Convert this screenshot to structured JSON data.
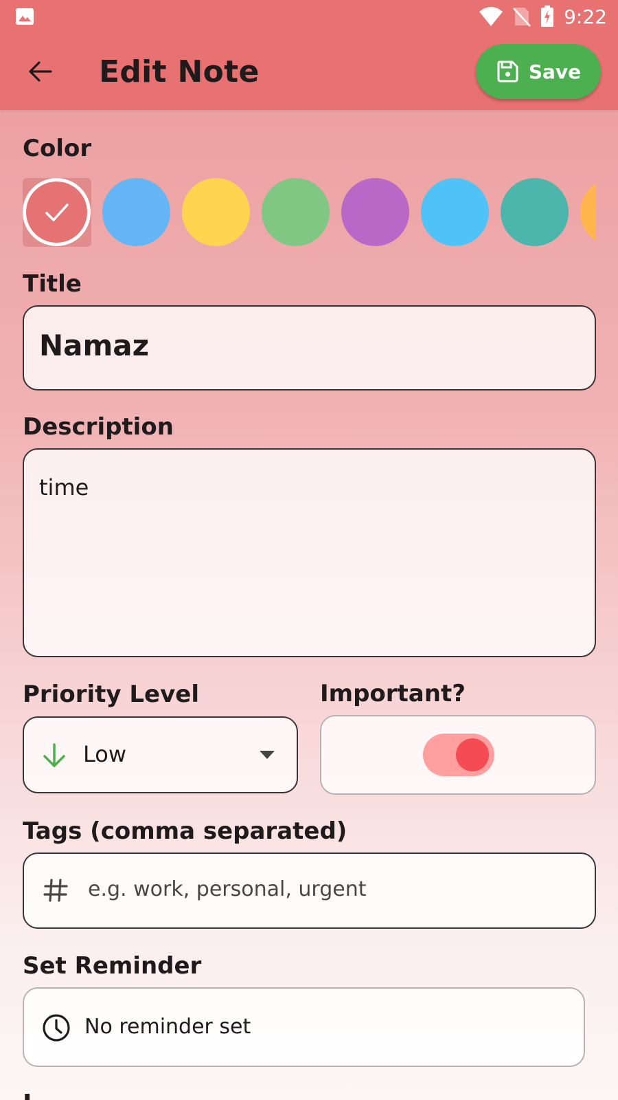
{
  "status_bar": {
    "time": "9:22",
    "icons": [
      "image-notification-icon",
      "wifi-icon",
      "no-sim-icon",
      "battery-charging-icon"
    ]
  },
  "app_bar": {
    "title": "Edit Note",
    "save_label": "Save",
    "colors": {
      "app_bar": "#e87272",
      "save_button": "#4caf50"
    }
  },
  "color_section": {
    "label": "Color",
    "swatches": [
      "#e57373",
      "#64b5f6",
      "#ffd54f",
      "#81c784",
      "#ba68c8",
      "#4fc3f7",
      "#4db6ac",
      "#ffb74d"
    ],
    "selected_index": 0
  },
  "title_section": {
    "label": "Title",
    "value": "Namaz"
  },
  "description_section": {
    "label": "Description",
    "value": "time"
  },
  "priority_section": {
    "label": "Priority Level",
    "value": "Low",
    "icon": "arrow-down-icon",
    "icon_color": "#4caf50"
  },
  "important_section": {
    "label": "Important?",
    "toggle_on": true
  },
  "tags_section": {
    "label": "Tags (comma separated)",
    "placeholder": "e.g. work, personal, urgent",
    "icon": "hash-icon"
  },
  "reminder_section": {
    "label": "Set Reminder",
    "value": "No reminder set",
    "icon": "clock-icon"
  },
  "next_section": {
    "label": "L"
  }
}
